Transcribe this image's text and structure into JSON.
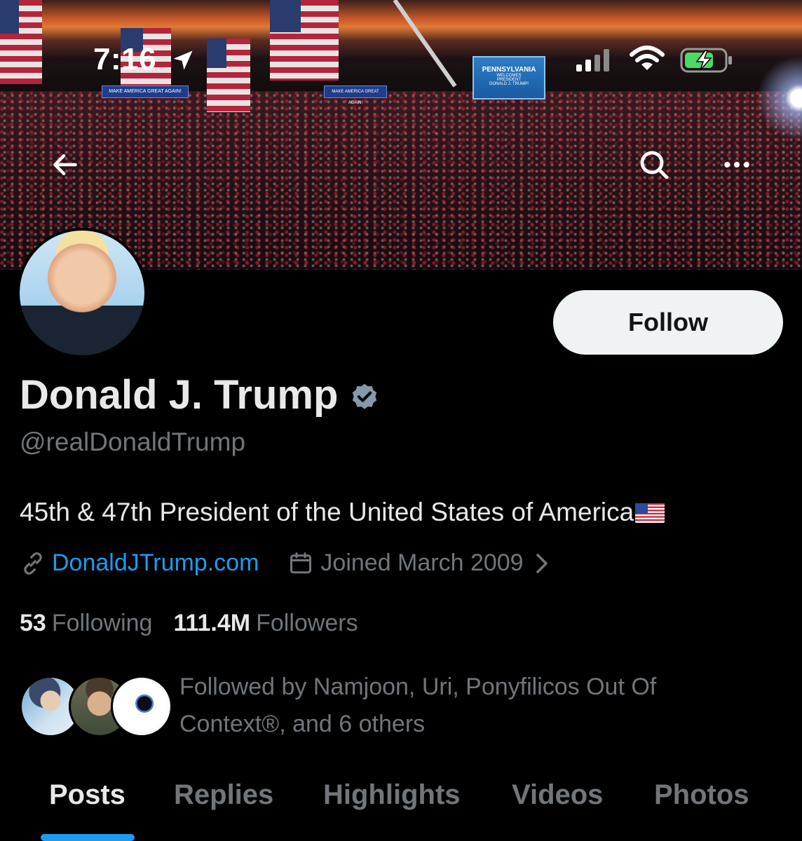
{
  "status_bar": {
    "time": "7:16"
  },
  "banner": {
    "signs": [
      "MAKE AMERICA GREAT AGAIN!",
      "MAKE AMERICA GREAT AGAIN!"
    ],
    "screen_sign": [
      "PENNSYLVANIA",
      "WELCOMES",
      "PRESIDENT",
      "DONALD J. TRUMP!"
    ]
  },
  "header": {
    "icons": [
      "arrow-left-icon",
      "search-icon",
      "more-dots-icon"
    ]
  },
  "profile": {
    "follow_label": "Follow",
    "display_name": "Donald J. Trump",
    "handle": "@realDonaldTrump",
    "bio": "45th & 47th President of the United States of America",
    "website": "DonaldJTrump.com",
    "joined": "Joined March 2009",
    "following_count": "53",
    "following_label": "Following",
    "followers_count": "111.4M",
    "followers_label": "Followers",
    "followed_by": "Followed by Namjoon, Uri, Ponyfilicos Out Of Context®, and 6 others"
  },
  "tabs": [
    {
      "label": "Posts",
      "active": true
    },
    {
      "label": "Replies",
      "active": false
    },
    {
      "label": "Highlights",
      "active": false
    },
    {
      "label": "Videos",
      "active": false
    },
    {
      "label": "Photos",
      "active": false
    }
  ],
  "colors": {
    "background": "#000000",
    "accent": "#1d9bf0",
    "secondary_text": "#71767b",
    "primary_text": "#e7e9ea"
  }
}
